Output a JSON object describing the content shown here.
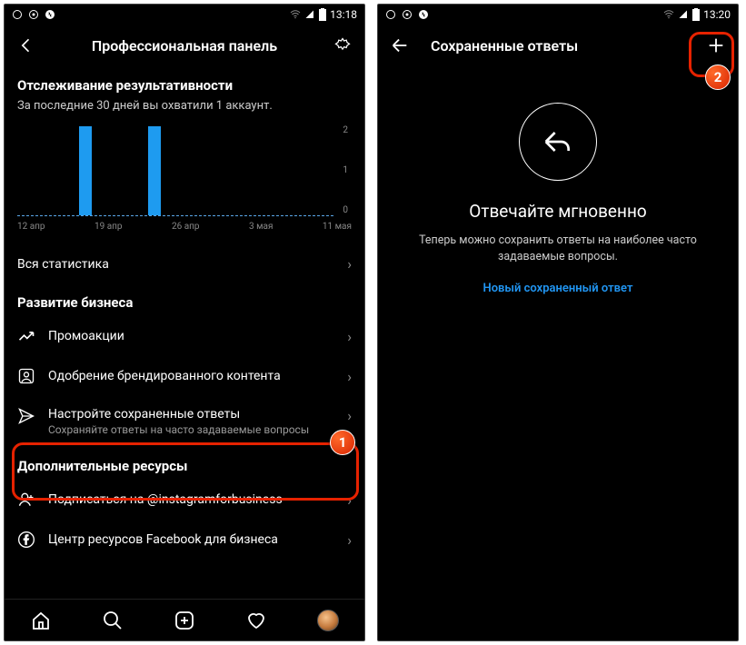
{
  "screen1": {
    "status": {
      "time": "13:18"
    },
    "header": {
      "title": "Профессиональная панель"
    },
    "perf": {
      "title": "Отслеживание результативности",
      "subtitle": "За последние 30 дней вы охватили 1 аккаунт."
    },
    "chart_data": {
      "type": "bar",
      "categories": [
        "12 апр",
        "19 апр",
        "26 апр",
        "3 мая",
        "11 мая"
      ],
      "values": [
        0,
        2,
        2,
        0,
        0
      ],
      "title": "",
      "xlabel": "",
      "ylabel": "",
      "ylim": [
        0,
        2
      ],
      "y_ticks": [
        "2",
        "1",
        "0"
      ]
    },
    "stats_link": "Вся статистика",
    "biz": {
      "title": "Развитие бизнеса",
      "items": [
        {
          "label": "Промоакции"
        },
        {
          "label": "Одобрение брендированного контента"
        },
        {
          "label": "Настройте сохраненные ответы",
          "sub": "Сохраняйте ответы на часто задаваемые вопросы"
        }
      ]
    },
    "extra": {
      "title": "Дополнительные ресурсы",
      "items": [
        {
          "label": "Подписаться на @instagramforbusiness"
        },
        {
          "label": "Центр ресурсов Facebook для бизнеса"
        }
      ]
    },
    "badge": "1"
  },
  "screen2": {
    "status": {
      "time": "13:20"
    },
    "header": {
      "title": "Сохраненные ответы"
    },
    "msg": {
      "title": "Отвечайте мгновенно",
      "body": "Теперь можно сохранить ответы на наиболее часто задаваемые вопросы.",
      "link": "Новый сохраненный ответ"
    },
    "badge": "2"
  }
}
